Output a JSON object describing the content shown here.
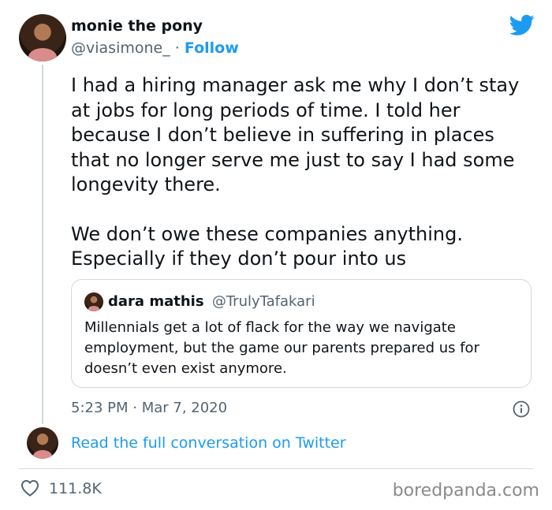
{
  "author": {
    "name": "monie the pony",
    "handle": "@viasimone_",
    "separator": "·",
    "follow_label": "Follow"
  },
  "tweet": {
    "paragraphs": [
      "I had a hiring manager ask me why I don’t stay at jobs for long periods of time. I told her because I don’t believe in suffering in places that no longer serve me just to say I had some longevity there.",
      "We don’t owe these companies anything. Especially if they don’t pour into us"
    ],
    "timestamp": "5:23 PM · Mar 7, 2020"
  },
  "quote": {
    "name": "dara mathis",
    "handle": "@TrulyTafakari",
    "text": "Millennials get a lot of flack for the way we navigate employment, but the game our parents prepared us for doesn’t even exist anymore."
  },
  "footer": {
    "read_full_label": "Read the full conversation on Twitter",
    "likes": "111.8K",
    "watermark": "boredpanda.com"
  },
  "colors": {
    "accent": "#1d9bf0",
    "secondary_text": "#536471",
    "border": "#cfd9de"
  },
  "icons": [
    "twitter-bird-icon",
    "info-icon",
    "heart-icon"
  ]
}
